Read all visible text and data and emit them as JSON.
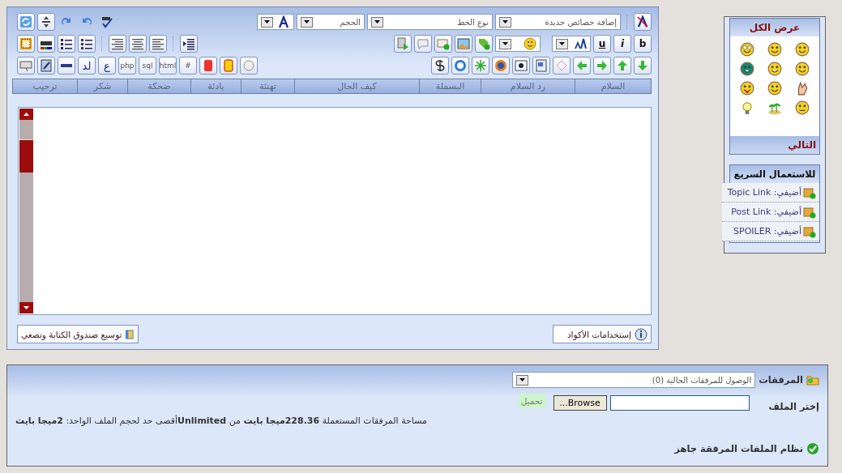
{
  "editor": {
    "toolbar": {
      "new_properties_select": "إضافة خصائص جديدة",
      "font_select": "نوع الخط",
      "size_select": "الحجم",
      "text_buttons": [
        "#",
        "html",
        "sql",
        "php",
        "ع",
        "لد"
      ],
      "format_buttons": [
        "b",
        "i",
        "u"
      ]
    },
    "quick_phrases": [
      "السلام",
      "رد السلام",
      "البسملة",
      "كيف الحال",
      "تهنئة",
      "بادئة",
      "ضحكة",
      "شكر",
      "ترحيب"
    ],
    "expand_button": "توسيع صندوق الكتابة وتصغي",
    "codes_button": "إستخدامات الأكواد"
  },
  "smilies_panel": {
    "title": "عرض الكل",
    "next": "التالي"
  },
  "quick_panel": {
    "title": "للاستعمال السريع",
    "items": [
      {
        "label": "أضيفي: Topic Link"
      },
      {
        "label": "أضيفي: Post Link"
      },
      {
        "label": "أضيفي: SPOILER"
      }
    ]
  },
  "attachments": {
    "label": "المرفقات",
    "select": "الوصول للمرفقات الحالية (0)",
    "file_label": "إختر الملف",
    "browse_button": "Browse...",
    "upload_button": "تحميل",
    "usage": "مساحة المرفقات المستعملة **228.36ميجا بايت** من **Unlimited**أقصى حد لحجم الملف الواحد: **2ميجا بايت**",
    "status": "نظام الملفات المرفقة جاهز"
  }
}
